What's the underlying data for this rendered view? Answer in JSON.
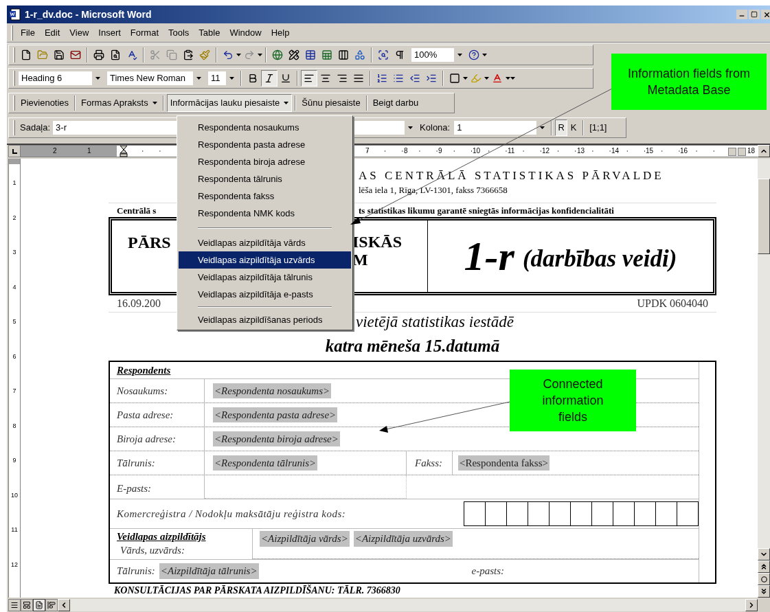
{
  "window": {
    "title": "1-r_dv.doc - Microsoft Word"
  },
  "menu_bar": [
    "File",
    "Edit",
    "View",
    "Insert",
    "Format",
    "Tools",
    "Table",
    "Window",
    "Help"
  ],
  "standard_toolbar": {
    "zoom": "100%"
  },
  "formatting_toolbar": {
    "style": "Heading 6",
    "font": "Times New Roman",
    "size": "11",
    "buttons": [
      {
        "kind": "bold",
        "pressed": false
      },
      {
        "kind": "italic",
        "pressed": true
      },
      {
        "kind": "underline",
        "pressed": false
      },
      {
        "kind": "align-left",
        "pressed": true
      },
      {
        "kind": "align-center",
        "pressed": false
      },
      {
        "kind": "align-right",
        "pressed": false
      },
      {
        "kind": "justify",
        "pressed": false
      },
      {
        "kind": "numbering",
        "pressed": false
      },
      {
        "kind": "bullets",
        "pressed": false
      },
      {
        "kind": "outdent",
        "pressed": false
      },
      {
        "kind": "indent",
        "pressed": false
      }
    ]
  },
  "custom_toolbar": {
    "buttons": [
      {
        "label": "Pievienoties",
        "dropdown": false,
        "pressed": false
      },
      {
        "label": "Formas Apraksts",
        "dropdown": true,
        "pressed": false
      },
      {
        "label": "Informācijas lauku piesaiste",
        "dropdown": true,
        "pressed": true
      },
      {
        "label": "Šūnu piesaiste",
        "dropdown": false,
        "pressed": false
      },
      {
        "label": "Beigt darbu",
        "dropdown": false,
        "pressed": false
      }
    ]
  },
  "navigation_toolbar": {
    "section_label": "Sadaļa:",
    "section_value": "3-r",
    "column_label": "Kolona:",
    "column_value": "1",
    "toggles": [
      {
        "label": "R",
        "pressed": true
      },
      {
        "label": "K",
        "pressed": false
      }
    ],
    "position": "[1;1]"
  },
  "dropdown_menu": {
    "groups": [
      [
        {
          "label": "Respondenta nosaukums",
          "selected": false
        },
        {
          "label": "Respondenta pasta adrese",
          "selected": false
        },
        {
          "label": "Respondenta biroja adrese",
          "selected": false
        },
        {
          "label": "Respondenta tālrunis",
          "selected": false
        },
        {
          "label": "Respondenta fakss",
          "selected": false
        },
        {
          "label": "Respondenta NMK kods",
          "selected": false
        }
      ],
      [
        {
          "label": "Veidlapas aizpildītāja vārds",
          "selected": false
        },
        {
          "label": "Veidlapas aizpildītāja uzvārds",
          "selected": true
        },
        {
          "label": "Veidlapas aizpildītāja tālrunis",
          "selected": false
        },
        {
          "label": "Veidlapas aizpildītāja e-pasts",
          "selected": false
        }
      ],
      [
        {
          "label": "Veidlapas aizpildīšanas periods",
          "selected": false
        }
      ]
    ]
  },
  "ruler": {
    "left_labels": [
      "2",
      "1"
    ],
    "right_labels": [
      "7",
      "8",
      "9",
      "10",
      "11",
      "12",
      "13",
      "14",
      "15",
      "16",
      "18"
    ],
    "vertical_labels": [
      "1",
      "2",
      "3",
      "4",
      "5",
      "6",
      "7",
      "8",
      "9",
      "10",
      "11",
      "12"
    ]
  },
  "document": {
    "header_title": "AS CENTRĀLĀ STATISTIKAS PĀRVALDE",
    "header_address": "lēša iela 1, Rīga, LV-1301, fakss 7366658",
    "confidentiality_left": "Centrālā s",
    "confidentiality_right": "ts statistikas likumu garantē sniegtās informācijas konfidencialitāti",
    "report_title_left": "PĀRS",
    "report_title_middle": [
      "ISKĀS",
      "M"
    ],
    "form_code": "1-r",
    "form_subtitle": "(darbības veidi)",
    "date": "16.09.200",
    "updk": "UPDK 0604040",
    "submit_to": "vietējā statistikas iestādē",
    "deadline": "katra mēneša 15.datumā",
    "respondent": {
      "heading": "Respondents",
      "fields": [
        {
          "label": "Nosaukums:",
          "value": "<Respondenta nosaukums>"
        },
        {
          "label": "Pasta adrese:",
          "value": "<Respondenta pasta adrese>"
        },
        {
          "label": "Biroja adrese:",
          "value": "<Respondenta biroja adrese>"
        }
      ],
      "phone": {
        "label": "Tālrunis:",
        "value": "<Respondenta tālrunis>"
      },
      "fax": {
        "label": "Fakss:",
        "value": "<Respondenta fakss>"
      },
      "email_label": "E-pasts:",
      "registry_label": "Komercreģistra / Nodokļu maksātāju reģistra kods:"
    },
    "filler": {
      "heading": "Veidlapas aizpildītājs",
      "name_label": "Vārds, uzvārds:",
      "first_name": "<Aizpildītāja vārds>",
      "last_name": "<Aizpildītāja uzvārds>",
      "phone_label": "Tālrunis:",
      "phone": "<Aizpildītāja tālrunis>",
      "email_label": "e-pasts:"
    },
    "footer": "KONSULTĀCIJAS PAR PĀRSKATA AIZPILDĪŠANU: TĀLR. 7366830"
  },
  "callouts": [
    {
      "text": "Information fields from Metadata Base"
    },
    {
      "text": "Connected information fields"
    }
  ]
}
